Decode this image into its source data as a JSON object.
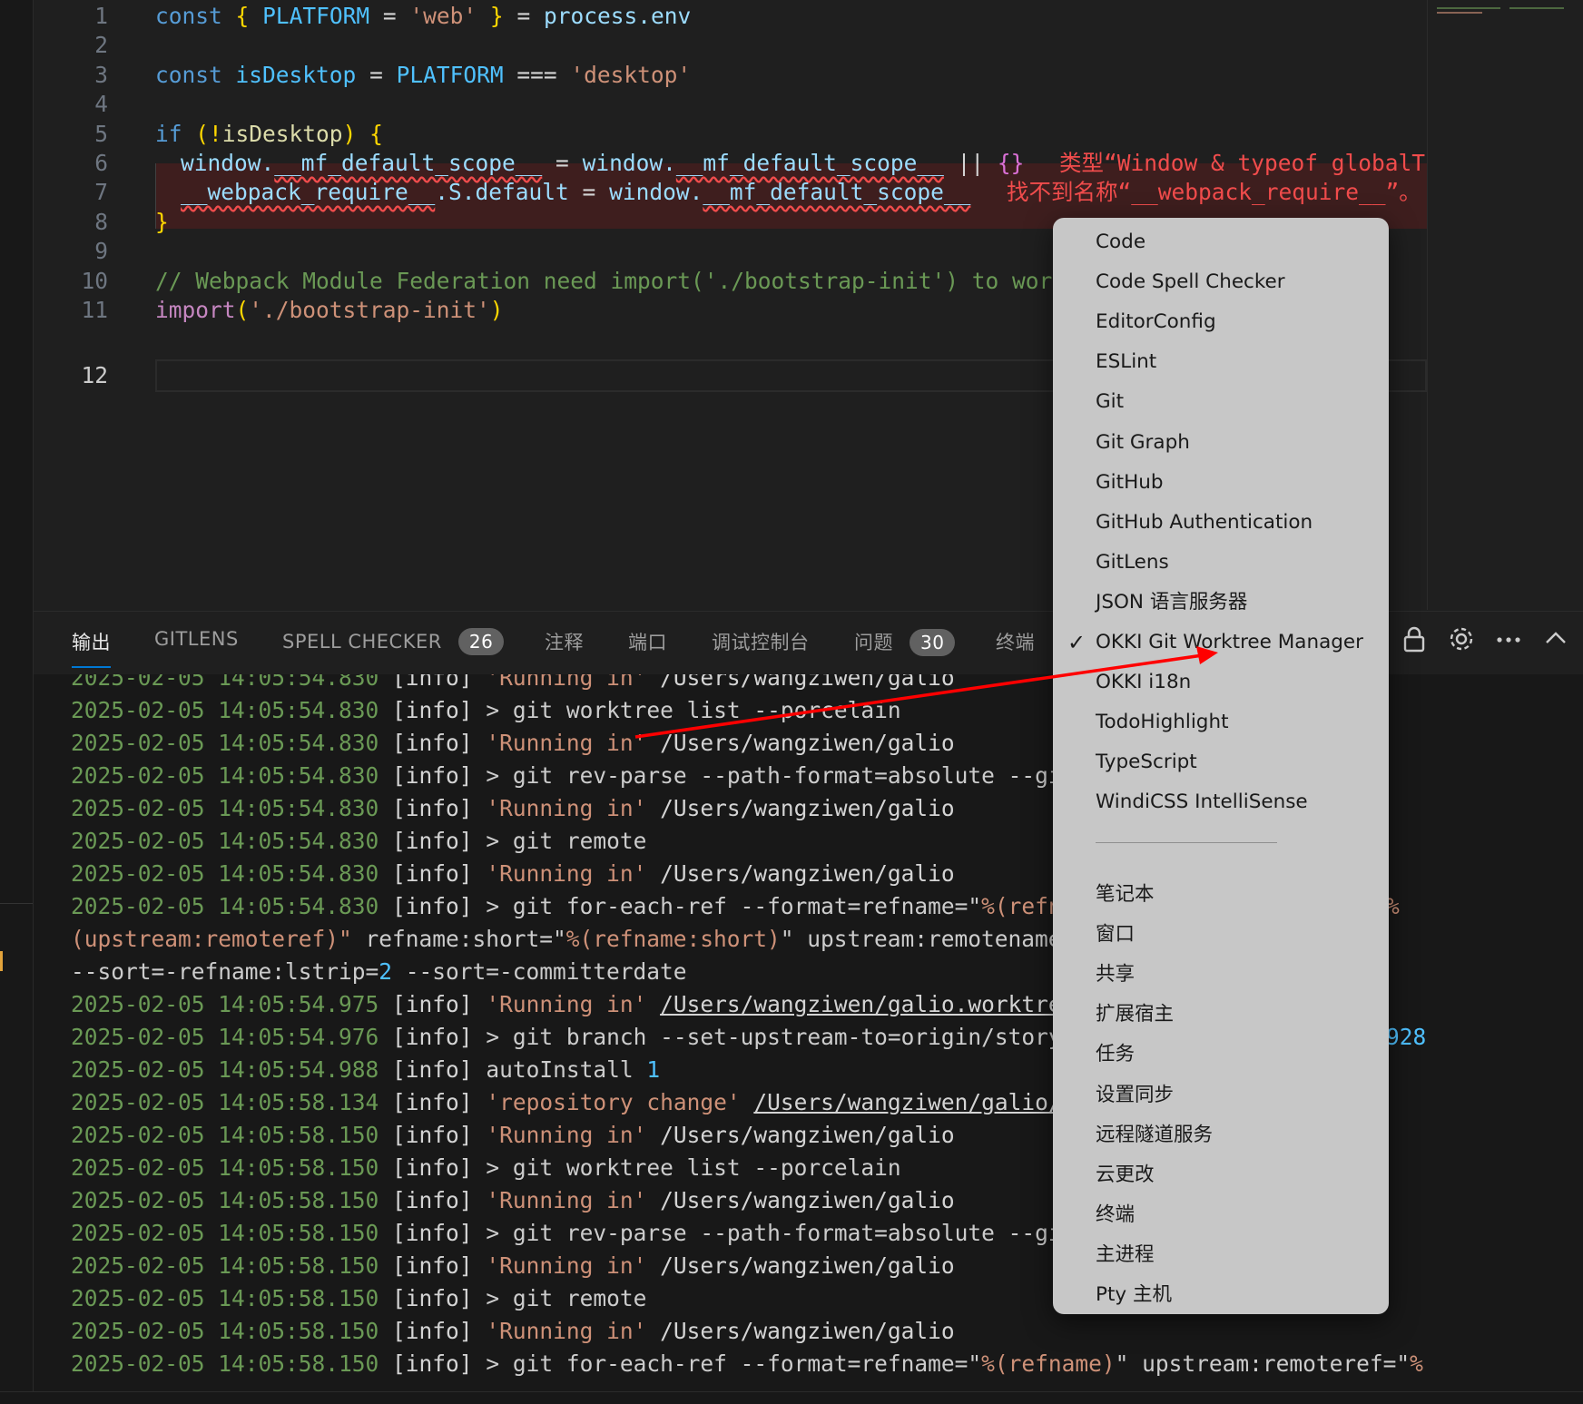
{
  "editor": {
    "line_numbers": [
      "1",
      "2",
      "3",
      "4",
      "5",
      "6",
      "7",
      "8",
      "9",
      "10",
      "11",
      "12"
    ],
    "lines": {
      "l1": {
        "kw": "const",
        "b1": "{",
        "name": "PLATFORM",
        "eq": "=",
        "val": "'web'",
        "b2": "}",
        "eq2": "=",
        "rhs": "process.env"
      },
      "l3": {
        "kw": "const",
        "name": "isDesktop",
        "eq": "=",
        "c": "PLATFORM",
        "op": "===",
        "val": "'desktop'"
      },
      "l5": {
        "kw": "if",
        "p1": "(!",
        "name": "isDesktop",
        "p2": ")",
        "b": "{"
      },
      "l6": {
        "w": "window.",
        "p": "__mf_default_scope__",
        "eq": "=",
        "w2": "window.",
        "p2": "__mf_default_scope__",
        "op": "||",
        "obj": "{}",
        "err": "类型“Window & typeof globalTh"
      },
      "l7": {
        "p": "__webpack_require__",
        "s": ".S.default",
        "eq": "=",
        "w2": "window.",
        "p2": "__mf_default_scope__",
        "err": "找不到名称“__webpack_require__”。"
      },
      "l8": {
        "b": "}"
      },
      "l10": {
        "comment": "// Webpack Module Federation need import('./bootstrap-init') to work"
      },
      "l11": {
        "kw": "import",
        "p1": "(",
        "val": "'./bootstrap-init'",
        "p2": ")"
      }
    }
  },
  "panel": {
    "tabs": [
      {
        "label": "输出"
      },
      {
        "label": "GITLENS"
      },
      {
        "label": "SPELL CHECKER",
        "badge": "26"
      },
      {
        "label": "注释"
      },
      {
        "label": "端口"
      },
      {
        "label": "调试控制台"
      },
      {
        "label": "问题",
        "badge": "30"
      },
      {
        "label": "终端"
      }
    ],
    "icons": [
      "lock-icon",
      "gear-icon",
      "more-icon",
      "chevron-up-icon"
    ]
  },
  "output": {
    "lines": [
      {
        "ts": "2025-02-05 14:05:54.830",
        "lvl": "[info]",
        "msg_q": "'Running in'",
        "msg": " /Users/wangziwen/galio"
      },
      {
        "ts": "2025-02-05 14:05:54.830",
        "lvl": "[info]",
        "msg": "> git worktree list --porcelain"
      },
      {
        "ts": "2025-02-05 14:05:54.830",
        "lvl": "[info]",
        "msg_q": "'Running in'",
        "msg": " /Users/wangziwen/galio"
      },
      {
        "ts": "2025-02-05 14:05:54.830",
        "lvl": "[info]",
        "msg": "> git rev-parse --path-format=absolute --git"
      },
      {
        "ts": "2025-02-05 14:05:54.830",
        "lvl": "[info]",
        "msg_q": "'Running in'",
        "msg": " /Users/wangziwen/galio"
      },
      {
        "ts": "2025-02-05 14:05:54.830",
        "lvl": "[info]",
        "msg": "> git remote"
      },
      {
        "ts": "2025-02-05 14:05:54.830",
        "lvl": "[info]",
        "msg_q": "'Running in'",
        "msg": " /Users/wangziwen/galio"
      },
      {
        "ts": "2025-02-05 14:05:54.830",
        "lvl": "[info]",
        "msg": "> git for-each-ref --format=refname=\"",
        "msg_q2": "%(refna"
      },
      {
        "cont_q": "(upstream:remoteref)\"",
        "cont": " refname:short=\"",
        "cont_q2": "%(refname:short)",
        "cont2": "\" upstream:remotename="
      },
      {
        "cont": "--sort=-refname:lstrip=",
        "cont_num": "2",
        "cont2": " --sort=-committerdate"
      },
      {
        "ts": "2025-02-05 14:05:54.975",
        "lvl": "[info]",
        "msg_q": "'Running in'",
        "msg": " ",
        "msg_u": "/Users/wangziwen/galio.worktree"
      },
      {
        "ts": "2025-02-05 14:05:54.976",
        "lvl": "[info]",
        "msg": "> git branch --set-upstream-to=origin/story/"
      },
      {
        "ts": "2025-02-05 14:05:54.988",
        "lvl": "[info]",
        "msg": "autoInstall ",
        "msg_num": "1"
      },
      {
        "ts": "2025-02-05 14:05:58.134",
        "lvl": "[info]",
        "msg_q": "'repository change'",
        "msg": " ",
        "msg_u": "/Users/wangziwen/galio/."
      },
      {
        "ts": "2025-02-05 14:05:58.150",
        "lvl": "[info]",
        "msg_q": "'Running in'",
        "msg": " /Users/wangziwen/galio"
      },
      {
        "ts": "2025-02-05 14:05:58.150",
        "lvl": "[info]",
        "msg": "> git worktree list --porcelain"
      },
      {
        "ts": "2025-02-05 14:05:58.150",
        "lvl": "[info]",
        "msg_q": "'Running in'",
        "msg": " /Users/wangziwen/galio"
      },
      {
        "ts": "2025-02-05 14:05:58.150",
        "lvl": "[info]",
        "msg": "> git rev-parse --path-format=absolute --git"
      },
      {
        "ts": "2025-02-05 14:05:58.150",
        "lvl": "[info]",
        "msg_q": "'Running in'",
        "msg": " /Users/wangziwen/galio"
      },
      {
        "ts": "2025-02-05 14:05:58.150",
        "lvl": "[info]",
        "msg": "> git remote"
      },
      {
        "ts": "2025-02-05 14:05:58.150",
        "lvl": "[info]",
        "msg_q": "'Running in'",
        "msg": " /Users/wangziwen/galio"
      },
      {
        "ts": "2025-02-05 14:05:58.150",
        "lvl": "[info]",
        "msg": "> git for-each-ref --format=refname=\"",
        "msg_q2": "%(refname)",
        "msg2": "\" upstream:remoteref=\"",
        "msg_q3": "%"
      }
    ],
    "tails": {
      "t1": "%",
      "t2": "928"
    }
  },
  "menu": {
    "items": [
      {
        "label": "Code",
        "checked": false
      },
      {
        "label": "Code Spell Checker",
        "checked": false
      },
      {
        "label": "EditorConfig",
        "checked": false
      },
      {
        "label": "ESLint",
        "checked": false
      },
      {
        "label": "Git",
        "checked": false
      },
      {
        "label": "Git Graph",
        "checked": false
      },
      {
        "label": "GitHub",
        "checked": false
      },
      {
        "label": "GitHub Authentication",
        "checked": false
      },
      {
        "label": "GitLens",
        "checked": false
      },
      {
        "label": "JSON 语言服务器",
        "checked": false
      },
      {
        "label": "OKKI Git Worktree Manager",
        "checked": true
      },
      {
        "label": "OKKI i18n",
        "checked": false
      },
      {
        "label": "TodoHighlight",
        "checked": false
      },
      {
        "label": "TypeScript",
        "checked": false
      },
      {
        "label": "WindiCSS IntelliSense",
        "checked": false
      }
    ],
    "items2": [
      {
        "label": "笔记本"
      },
      {
        "label": "窗口"
      },
      {
        "label": "共享"
      },
      {
        "label": "扩展宿主"
      },
      {
        "label": "任务"
      },
      {
        "label": "设置同步"
      },
      {
        "label": "远程隧道服务"
      },
      {
        "label": "云更改"
      },
      {
        "label": "终端"
      },
      {
        "label": "主进程"
      },
      {
        "label": "Pty 主机"
      }
    ],
    "check_glyph": "✓"
  },
  "colors": {
    "accent": "#0078d4",
    "arrow": "#ff0000",
    "menu_bg": "#c7c7c7",
    "error": "#f14c4c"
  }
}
